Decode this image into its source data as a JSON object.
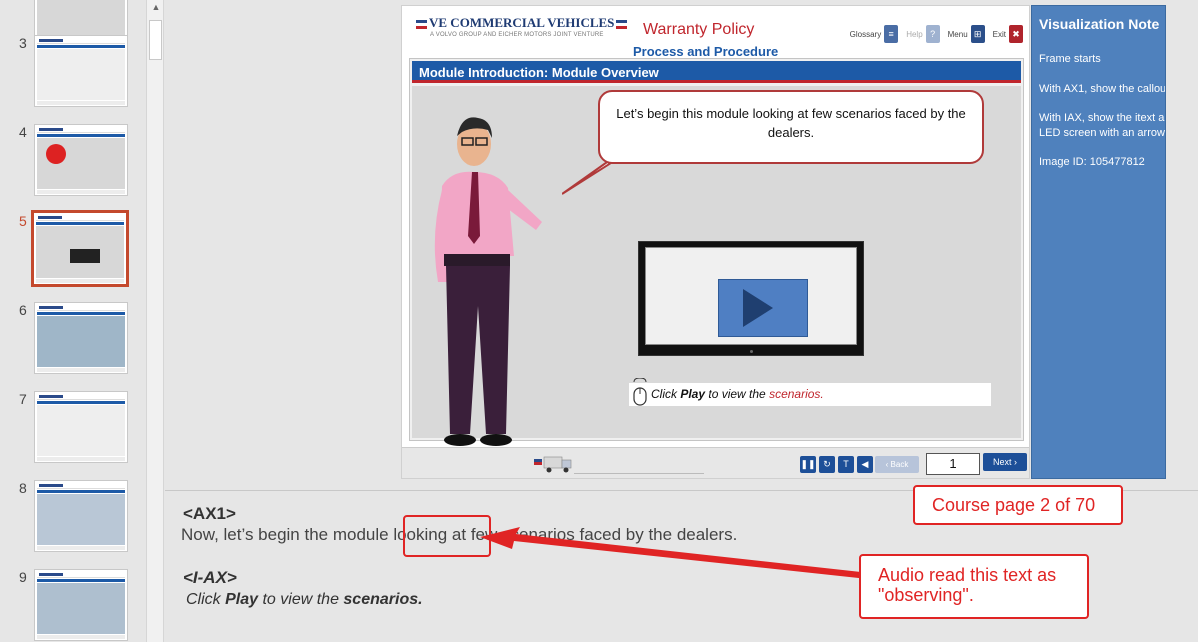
{
  "thumbnails": [
    {
      "num": "3"
    },
    {
      "num": "4"
    },
    {
      "num": "5",
      "selected": true
    },
    {
      "num": "6"
    },
    {
      "num": "7"
    },
    {
      "num": "8"
    },
    {
      "num": "9"
    }
  ],
  "slide": {
    "brand": "VE COMMERCIAL VEHICLES",
    "brand_sub": "A VOLVO GROUP AND EICHER MOTORS JOINT VENTURE",
    "course_title": "Warranty Policy",
    "course_subtitle": "Process and Procedure",
    "nav": {
      "glossary": "Glossary",
      "help": "Help",
      "menu": "Menu",
      "exit": "Exit"
    },
    "module_title": "Module Introduction: Module Overview",
    "callout": "Let’s begin this module looking at few scenarios faced by the dealers.",
    "hint": {
      "prefix": "Click ",
      "bold": "Play",
      "middle": " to view the ",
      "red": "scenarios."
    },
    "footer": {
      "back": "Back",
      "page": "1",
      "next": "Next"
    }
  },
  "viz_note": {
    "title": "Visualization Note",
    "lines": [
      "Frame starts",
      "With AX1, show the callou",
      "With IAX, show the itext a",
      "LED screen with an arrow.",
      "Image ID: 105477812"
    ]
  },
  "notes": {
    "h1": "<AX1>",
    "p1": "Now, let’s begin the module looking at few scenarios faced by the dealers.",
    "h2": "<I-AX>",
    "p2_prefix": " Click ",
    "p2_bold1": "Play",
    "p2_mid": " to view the ",
    "p2_bold2": "scenarios."
  },
  "annotations": {
    "course_page": "Course page 2 of 70",
    "audio_note": "Audio read this text as \"observing\"."
  },
  "colors": {
    "accent_red": "#e02424",
    "brand_blue": "#1d5aa7",
    "viz_blue": "#4f81bd",
    "selected_thumb": "#c4492d"
  }
}
